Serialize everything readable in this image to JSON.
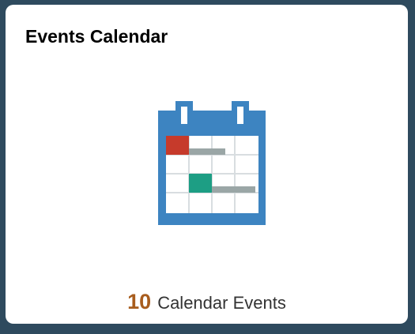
{
  "tile": {
    "title": "Events Calendar",
    "icon": "calendar-icon",
    "count": "10",
    "count_label": "Calendar Events"
  },
  "colors": {
    "page_background": "#2e4a5e",
    "tile_background": "#ffffff",
    "calendar_frame": "#3d84c1",
    "event_red": "#c63a2b",
    "event_teal": "#1d9e84",
    "event_bar_gray": "#9aa6a6",
    "count_color": "#a85d1e"
  }
}
